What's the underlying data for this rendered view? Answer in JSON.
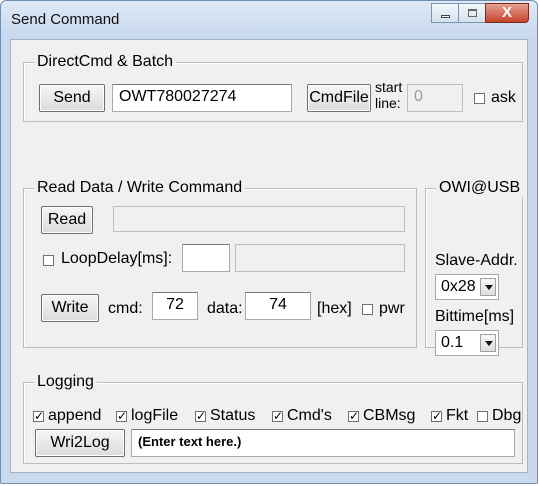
{
  "window": {
    "title": "Send Command",
    "close_glyph": "X"
  },
  "direct": {
    "group_label": "DirectCmd & Batch",
    "send_label": "Send",
    "command_value": "OWT780027274",
    "cmdfile_label": "CmdFile",
    "start_line_label_1": "start",
    "start_line_label_2": "line:",
    "start_line_value": "0",
    "ask_label": "ask",
    "ask_checked": false
  },
  "readwrite": {
    "group_label": "Read Data / Write Command",
    "read_label": "Read",
    "read_value": "",
    "loopdelay_label": "LoopDelay[ms]:",
    "loopdelay_checked": false,
    "loopdelay_value": "",
    "loop_output_value": "",
    "write_label": "Write",
    "cmd_label": "cmd:",
    "cmd_value": "72",
    "data_label": "data:",
    "data_value": "74",
    "hex_label": "[hex]",
    "pwr_label": "pwr",
    "pwr_checked": false
  },
  "owi": {
    "group_label": "OWI@USB",
    "slave_addr_label": "Slave-Addr.",
    "slave_addr_value": "0x28",
    "bittime_label": "Bittime[ms]",
    "bittime_value": "0.1"
  },
  "logging": {
    "group_label": "Logging",
    "options": [
      {
        "label": "append",
        "checked": true
      },
      {
        "label": "logFile",
        "checked": true
      },
      {
        "label": "Status",
        "checked": true
      },
      {
        "label": "Cmd's",
        "checked": true
      },
      {
        "label": "CBMsg",
        "checked": true
      },
      {
        "label": "Fkt",
        "checked": true
      },
      {
        "label": "Dbg",
        "checked": false
      }
    ],
    "wri2log_label": "Wri2Log",
    "log_text_placeholder": "(Enter text here.)"
  },
  "icons": {
    "minimize": "minimize-icon",
    "maximize": "maximize-icon",
    "close": "close-icon",
    "dropdown": "chevron-down-icon"
  },
  "colors": {
    "titlebar": "#c6d7ee",
    "close_button": "#c6432b",
    "face": "#f0f0f0"
  }
}
